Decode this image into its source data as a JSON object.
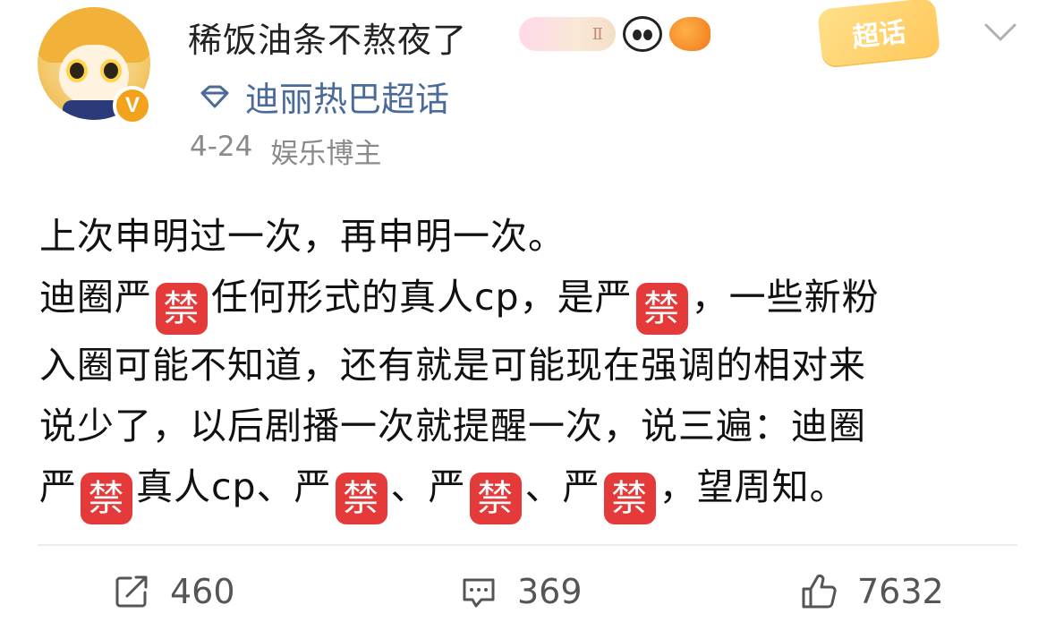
{
  "post": {
    "username": "稀饭油条不熬夜了",
    "badge_text": "Ⅱ",
    "verified_mark": "V",
    "supertopic": "迪丽热巴超话",
    "date": "4-24",
    "category": "娱乐博主",
    "chaohua_label": "超话",
    "ban_glyph": "禁"
  },
  "content": {
    "l1": "上次申明过一次，再申明一次。",
    "l2a": "迪圈严",
    "l2b": "任何形式的真人cp，是严",
    "l2c": "，一些新粉",
    "l3": "入圈可能不知道，还有就是可能现在强调的相对来",
    "l4": "说少了，以后剧播一次就提醒一次，说三遍：迪圈",
    "l5a": "严",
    "l5b": "真人cp、严",
    "l5c": "、严",
    "l5d": "、严",
    "l5e": "，望周知。"
  },
  "actions": {
    "share_count": "460",
    "comment_count": "369",
    "like_count": "7632"
  },
  "colors": {
    "supertopic": "#4a6a9a",
    "ban": "#e43a3a",
    "meta": "#8a8a8a"
  },
  "icons": [
    "share-icon",
    "comment-icon",
    "like-icon",
    "diamond-icon",
    "chevron-down-icon"
  ]
}
